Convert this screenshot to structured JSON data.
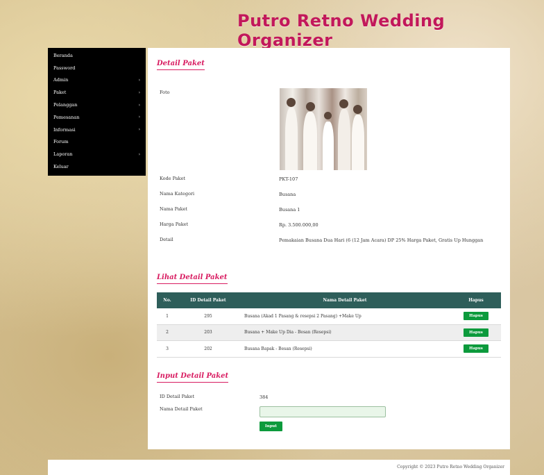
{
  "header": {
    "site_title": "Putro Retno Wedding Organizer"
  },
  "sidebar": {
    "items": [
      {
        "label": "Beranda",
        "has_submenu": false
      },
      {
        "label": "Password",
        "has_submenu": false
      },
      {
        "label": "Admin",
        "has_submenu": true
      },
      {
        "label": "Paket",
        "has_submenu": true
      },
      {
        "label": "Pelanggan",
        "has_submenu": true
      },
      {
        "label": "Pemesanan",
        "has_submenu": true
      },
      {
        "label": "Informasi",
        "has_submenu": true
      },
      {
        "label": "Forum",
        "has_submenu": false
      },
      {
        "label": "Laporan",
        "has_submenu": true
      },
      {
        "label": "Keluar",
        "has_submenu": false
      }
    ]
  },
  "detail": {
    "title": "Detail Paket",
    "foto_label": "Foto",
    "fields": [
      {
        "label": "Kode Paket",
        "value": "PKT-107"
      },
      {
        "label": "Nama Kategori",
        "value": "Busana"
      },
      {
        "label": "Nama Paket",
        "value": "Busana 1"
      },
      {
        "label": "Harga Paket",
        "value": "Rp. 3.500.000,00"
      },
      {
        "label": "Detail",
        "value": "Pemakaian Busana Dua Hari (6 (12 Jam Acara) DP 25% Harga Paket, Gratis Up Hunggan"
      }
    ]
  },
  "list": {
    "title": "Lihat Detail Paket",
    "columns": [
      "No.",
      "ID Detail Paket",
      "Nama Detail Paket",
      "Hapus"
    ],
    "rows": [
      {
        "no": "1",
        "id": "295",
        "name": "Busana (Akad 1 Pasang & resepsi 2 Pasang) +Make Up",
        "action": "Hapus"
      },
      {
        "no": "2",
        "id": "203",
        "name": "Busana + Make Up Dia - Besan (Resepsi)",
        "action": "Hapus"
      },
      {
        "no": "3",
        "id": "202",
        "name": "Busana Bapak - Besan (Resepsi)",
        "action": "Hapus"
      }
    ]
  },
  "input": {
    "title": "Input Detail Paket",
    "id_label": "ID Detail Paket",
    "id_value": "384",
    "name_label": "Nama Detail Paket",
    "name_value": "",
    "submit_label": "Input"
  },
  "footer": {
    "copyright": "Copyright © 2023 Putro Retno Wedding Organizer"
  }
}
